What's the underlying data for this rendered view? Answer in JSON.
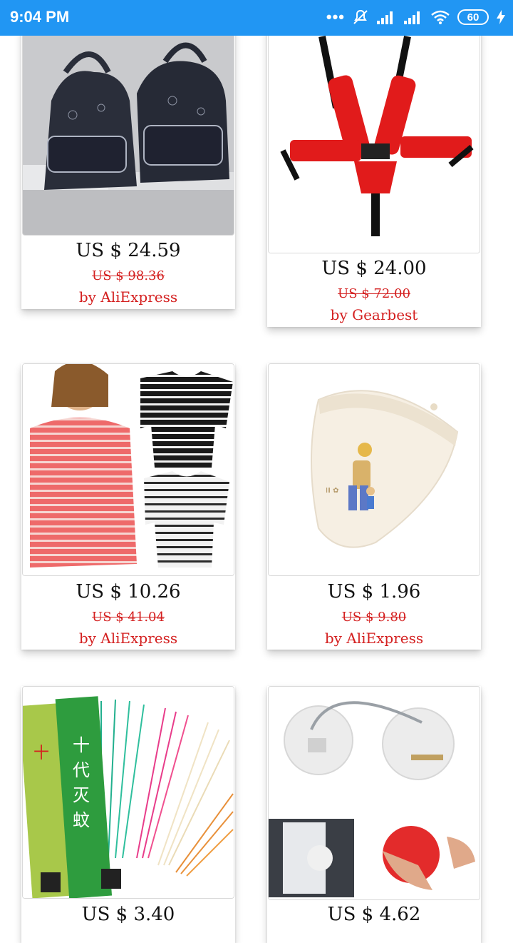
{
  "status_bar": {
    "time": "9:04 PM",
    "battery": "60",
    "icons": [
      "more-dots-icon",
      "silent-icon",
      "signal-icon",
      "signal-icon",
      "wifi-icon",
      "battery-icon",
      "charging-icon"
    ]
  },
  "colors": {
    "status_bar": "#2196f3",
    "price_old": "#d42020",
    "source": "#d42020"
  },
  "products": [
    {
      "image": "backpack-image",
      "price": "US $ 24.59",
      "original_price": "US $ 98.36",
      "source": "by AliExpress"
    },
    {
      "image": "safety-harness-image",
      "price": "US $ 24.00",
      "original_price": "US $ 72.00",
      "source": "by Gearbest"
    },
    {
      "image": "striped-shirt-image",
      "price": "US $ 10.26",
      "original_price": "US $ 41.04",
      "source": "by AliExpress"
    },
    {
      "image": "baby-bib-image",
      "price": "US $ 1.96",
      "original_price": "US $ 9.80",
      "source": "by AliExpress"
    },
    {
      "image": "incense-sticks-image",
      "price": "US $ 3.40",
      "original_price": "",
      "source": ""
    },
    {
      "image": "cable-lock-image",
      "price": "US $ 4.62",
      "original_price": "",
      "source": ""
    }
  ]
}
